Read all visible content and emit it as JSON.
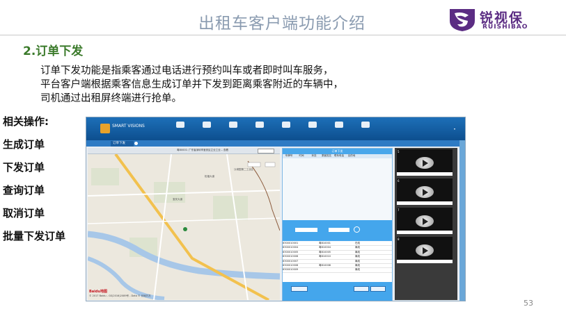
{
  "slide": {
    "title": "出租车客户端功能介绍",
    "logo_cn": "锐视保",
    "logo_en": "RUISHIBAO",
    "section": "2.订单下发",
    "paragraph": [
      "订单下发功能是指乘客通过电话进行预约叫车或者即时叫车服务，",
      "平台客户端根据乘客信息生成订单并下发到距离乘客附近的车辆中，",
      "司机通过出租屏终端进行抢单。"
    ],
    "ops_heading": "相关操作:",
    "ops": [
      "生成订单",
      "下发订单",
      "查询订单",
      "取消订单",
      "批量下发订单"
    ],
    "page_number": "53"
  },
  "app": {
    "brand": "SMART VISIONS",
    "tab_label": "订单下发",
    "nav_count": 8,
    "map": {
      "address_text": "粤B0001: 广东省深圳市宝安区立业工业... 查看",
      "labels": [
        "沙浦围第二工业区",
        "宝安大道",
        "松福大道",
        "Baidu地图"
      ],
      "copyright": "© 2017 Baidu - GS(2016)2089号 - Data © 长地万方"
    },
    "order_panel": {
      "header": "订单下发",
      "columns": [
        "车牌号",
        "时间",
        "状态",
        "乘客姓名",
        "联系电话",
        "目的地"
      ],
      "table_rows": [
        [
          "8300010001",
          "粤B10001",
          "在线"
        ],
        [
          "8300010004",
          "粤B10004",
          "离线"
        ],
        [
          "8300010005",
          "粤B10005",
          "离线"
        ],
        [
          "8300010006",
          "粤B10010",
          "离线"
        ],
        [
          "8300010007",
          "",
          "离线"
        ],
        [
          "8300010008",
          "粤B10008",
          "离线"
        ],
        [
          "8300010009",
          "",
          "离线"
        ]
      ]
    },
    "video_panel": {
      "slots": [
        "5",
        "6",
        "7",
        "8"
      ]
    }
  }
}
